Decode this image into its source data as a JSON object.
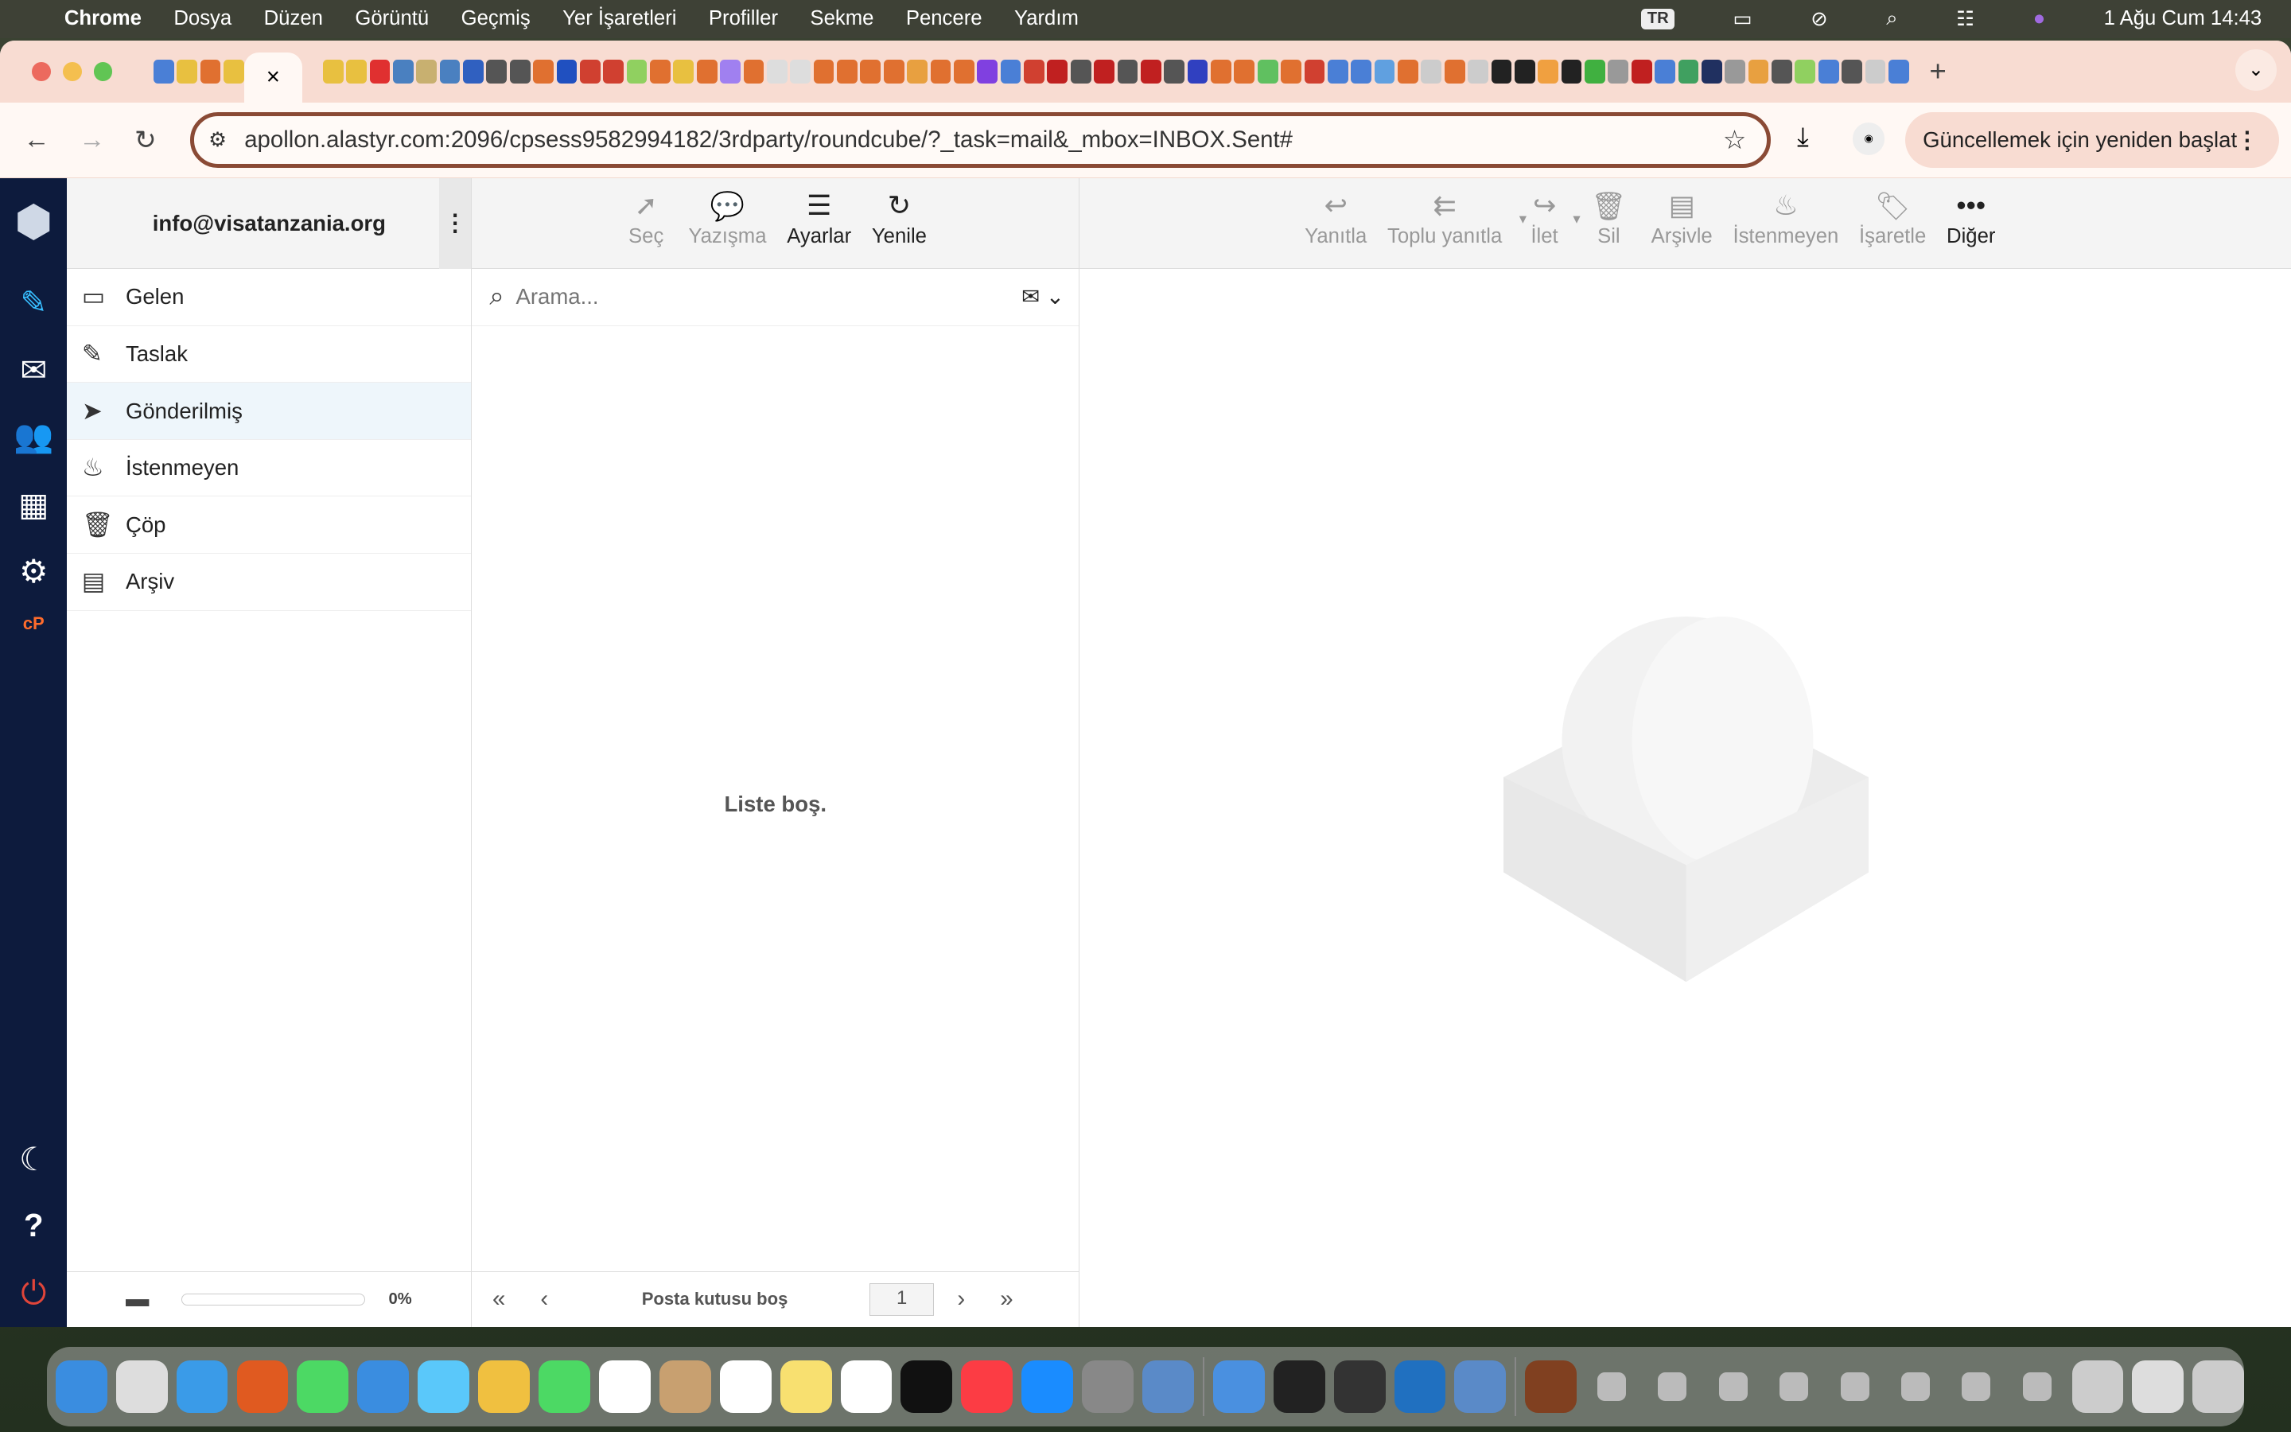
{
  "menubar": {
    "app": "Chrome",
    "items": [
      "Dosya",
      "Düzen",
      "Görüntü",
      "Geçmiş",
      "Yer İşaretleri",
      "Profiller",
      "Sekme",
      "Pencere",
      "Yardım"
    ],
    "input_source": "TR",
    "datetime": "1 Ağu Cum  14:43"
  },
  "browser": {
    "url": "apollon.alastyr.com:2096/cpsess9582994182/3rdparty/roundcube/?_task=mail&_mbox=INBOX.Sent#",
    "update_button": "Güncellemek için yeniden başlat",
    "active_tab_close": "×",
    "new_tab": "+",
    "tab_favicon_colors": [
      "#4a7fd6",
      "#e8c040",
      "#e07030",
      "#e8c040",
      "#e8c040",
      "#e8c040",
      "#e03030",
      "#4a80c0",
      "#c8b070",
      "#4a80c0",
      "#3060c0",
      "#555",
      "#555",
      "#e07030",
      "#2050c0",
      "#d04030",
      "#d04030",
      "#90d060",
      "#e07030",
      "#e8c040",
      "#e07030",
      "#a080f0",
      "#e07030",
      "#ddd",
      "#ddd",
      "#e07030",
      "#e07030",
      "#e07030",
      "#e07030",
      "#e8a040",
      "#e07030",
      "#e07030",
      "#8040e0",
      "#4a7fd6",
      "#d04030",
      "#c02020",
      "#555",
      "#c02020",
      "#555",
      "#c02020",
      "#555",
      "#3040c0",
      "#e07030",
      "#e07030",
      "#60c060",
      "#e07030",
      "#d04030",
      "#4a7fd6",
      "#4a7fd6",
      "#60a0e0",
      "#e07030",
      "#ccc",
      "#e07030",
      "#ccc",
      "#222",
      "#222",
      "#f0a040",
      "#222",
      "#40b040",
      "#999",
      "#c02020",
      "#4a7fd6",
      "#40a060",
      "#203060",
      "#999",
      "#e8a040",
      "#555",
      "#90d060",
      "#4a7fd6",
      "#555",
      "#ccc",
      "#4a7fd6"
    ]
  },
  "account": {
    "email": "info@visatanzania.org"
  },
  "folders": [
    {
      "icon": "inbox-icon",
      "glyph": "▭",
      "label": "Gelen"
    },
    {
      "icon": "pencil-icon",
      "glyph": "✎",
      "label": "Taslak"
    },
    {
      "icon": "paper-plane-icon",
      "glyph": "➤",
      "label": "Gönderilmiş",
      "selected": true
    },
    {
      "icon": "fire-icon",
      "glyph": "♨",
      "label": "İstenmeyen"
    },
    {
      "icon": "trash-icon",
      "glyph": "🗑",
      "label": "Çöp"
    },
    {
      "icon": "archive-icon",
      "glyph": "▤",
      "label": "Arşiv"
    }
  ],
  "quota": {
    "percent": 0,
    "label": "0%"
  },
  "list_toolbar": [
    {
      "icon": "pointer-icon",
      "glyph": "➚",
      "label": "Seç",
      "enabled": false
    },
    {
      "icon": "comments-icon",
      "glyph": "💬",
      "label": "Yazışma",
      "enabled": false
    },
    {
      "icon": "sliders-icon",
      "glyph": "☰",
      "label": "Ayarlar",
      "enabled": true
    },
    {
      "icon": "refresh-icon",
      "glyph": "↻",
      "label": "Yenile",
      "enabled": true
    }
  ],
  "search": {
    "placeholder": "Arama..."
  },
  "list": {
    "empty_text": "Liste boş.",
    "footer_text": "Posta kutusu boş",
    "page": "1"
  },
  "message_toolbar": [
    {
      "icon": "reply-icon",
      "glyph": "↩",
      "label": "Yanıtla"
    },
    {
      "icon": "reply-all-icon",
      "glyph": "⇇",
      "label": "Toplu yanıtla",
      "dropdown": true
    },
    {
      "icon": "forward-icon",
      "glyph": "↪",
      "label": "İlet",
      "dropdown": true
    },
    {
      "icon": "trash-icon",
      "glyph": "🗑",
      "label": "Sil"
    },
    {
      "icon": "archive-icon",
      "glyph": "▤",
      "label": "Arşivle"
    },
    {
      "icon": "fire-icon",
      "glyph": "♨",
      "label": "İstenmeyen"
    },
    {
      "icon": "tag-icon",
      "glyph": "🏷",
      "label": "İşaretle"
    },
    {
      "icon": "more-icon",
      "glyph": "•••",
      "label": "Diğer",
      "enabled": true
    }
  ],
  "dock_colors": [
    "#3a8de0",
    "#ddd",
    "#3a9be8",
    "#e05a20",
    "#4cd964",
    "#3a8de0",
    "#5ac8fa",
    "#f0c040",
    "#4cd964",
    "#fff",
    "#c8a070",
    "#fff",
    "#f8e070",
    "#fff",
    "#111",
    "#fc3c44",
    "#1a8cff",
    "#888",
    "#5a8ac8",
    "sep",
    "#4a90e0",
    "#222",
    "#333",
    "#2070c0",
    "#5a8ac8",
    "sep",
    "#804020",
    "sm",
    "sm",
    "sm",
    "sm",
    "sm",
    "sm",
    "sm",
    "sm",
    "#ccc",
    "#ddd",
    "#ccc"
  ]
}
